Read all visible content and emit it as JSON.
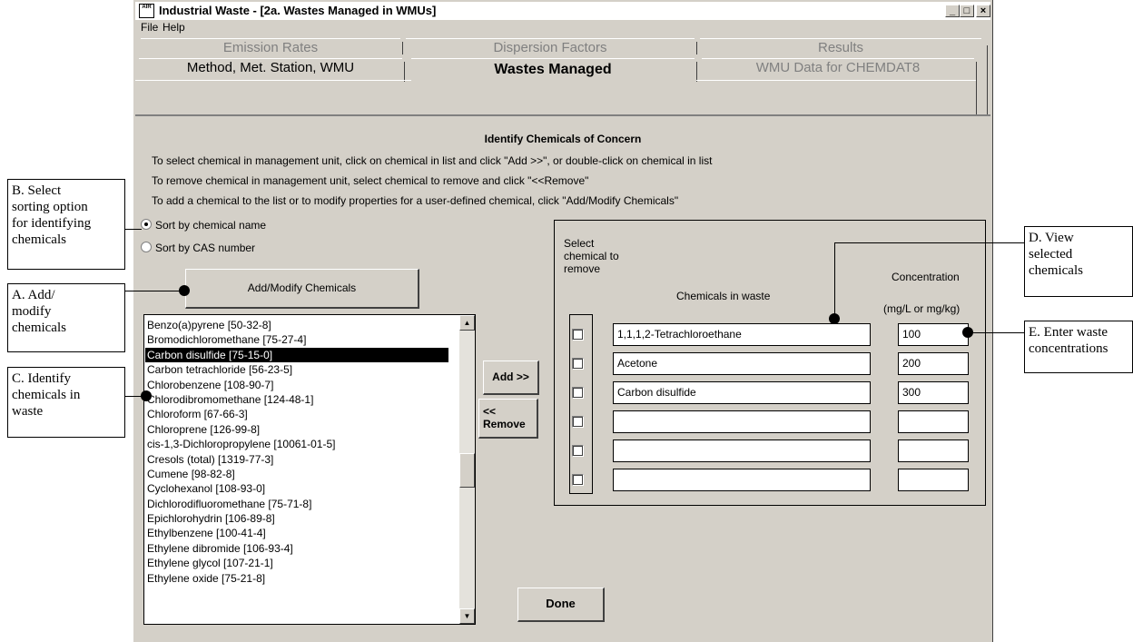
{
  "window": {
    "title": "Industrial Waste - [2a.  Wastes Managed in WMUs]",
    "app_icon_text": "AIR",
    "controls": {
      "minimize": "_",
      "maximize": "□",
      "close": "×"
    }
  },
  "menu": [
    {
      "label": "File",
      "mnemonic": "F"
    },
    {
      "label": "Help",
      "mnemonic": "H"
    }
  ],
  "tabs": {
    "back_row": [
      "Emission Rates",
      "Dispersion Factors",
      "Results"
    ],
    "front_row": [
      "Method, Met. Station, WMU",
      "Wastes Managed",
      "WMU Data for CHEMDAT8"
    ],
    "active": "Wastes Managed"
  },
  "content": {
    "heading": "Identify Chemicals of Concern",
    "instructions": [
      "To select chemical in management unit, click on chemical in list and click \"Add >>\",  or double-click on chemical in list",
      "To remove chemical in management unit, select chemical to remove and click \"<<Remove\"",
      "To add a chemical to the list or to modify properties for a user-defined chemical, click \"Add/Modify Chemicals\""
    ],
    "sort_options": [
      {
        "label": "Sort by chemical name",
        "selected": true
      },
      {
        "label": "Sort by CAS number",
        "selected": false
      }
    ],
    "add_modify_button": "Add/Modify Chemicals",
    "chemical_list": [
      "Benzo(a)pyrene  [50-32-8]",
      "Bromodichloromethane  [75-27-4]",
      "Carbon disulfide  [75-15-0]",
      "Carbon tetrachloride  [56-23-5]",
      "Chlorobenzene  [108-90-7]",
      "Chlorodibromomethane  [124-48-1]",
      "Chloroform  [67-66-3]",
      "Chloroprene  [126-99-8]",
      "cis-1,3-Dichloropropylene  [10061-01-5]",
      "Cresols (total)  [1319-77-3]",
      "Cumene  [98-82-8]",
      "Cyclohexanol  [108-93-0]",
      "Dichlorodifluoromethane  [75-71-8]",
      "Epichlorohydrin  [106-89-8]",
      "Ethylbenzene  [100-41-4]",
      "Ethylene dibromide  [106-93-4]",
      "Ethylene glycol  [107-21-1]",
      "Ethylene oxide  [75-21-8]"
    ],
    "selected_list_index": 2,
    "add_button": "Add >>",
    "remove_button": "<<\nRemove",
    "done_button": "Done",
    "selected_panel": {
      "remove_header": "Select\nchemical to\nremove",
      "chemicals_header": "Chemicals in waste",
      "concentration_header": "Concentration",
      "units_header": "(mg/L or mg/kg)",
      "rows": [
        {
          "chemical": "1,1,1,2-Tetrachloroethane",
          "concentration": "100"
        },
        {
          "chemical": "Acetone",
          "concentration": "200"
        },
        {
          "chemical": "Carbon disulfide",
          "concentration": "300"
        },
        {
          "chemical": "",
          "concentration": ""
        },
        {
          "chemical": "",
          "concentration": ""
        },
        {
          "chemical": "",
          "concentration": ""
        }
      ]
    }
  },
  "callouts": {
    "a": "A. Add/\nmodify\nchemicals",
    "b": "B. Select\nsorting option\nfor identifying\nchemicals",
    "c": "C. Identify\nchemicals in\nwaste",
    "d": "D. View\nselected\nchemicals",
    "e": "E. Enter waste\nconcentrations"
  }
}
